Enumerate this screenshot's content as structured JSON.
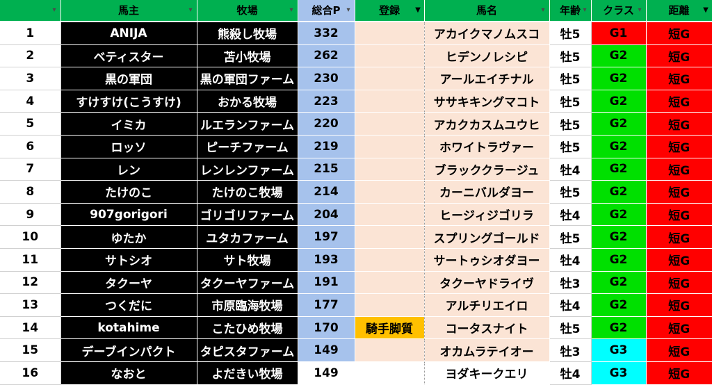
{
  "header": {
    "columns": [
      "",
      "馬主",
      "牧場",
      "総合P",
      "登録",
      "馬名",
      "年齢",
      "クラス",
      "距離"
    ],
    "filter_active": [
      false,
      false,
      false,
      false,
      true,
      false,
      false,
      false,
      true
    ]
  },
  "colors": {
    "G1": "#ff0000",
    "G2": "#00e000",
    "G3": "#00ffff",
    "header": "#00b050",
    "points": "#a6c2ec",
    "peach": "#fbe4d5",
    "jockey": "#ffc000"
  },
  "rows": [
    {
      "no": "1",
      "owner": "ANIJA",
      "farm": "熊殺し牧場",
      "points": "332",
      "reg": "",
      "horse": "アカイクマノムスコ",
      "age": "牡5",
      "cls": "G1",
      "dist": "短G"
    },
    {
      "no": "2",
      "owner": "ベティスター",
      "farm": "苫小牧場",
      "points": "262",
      "reg": "",
      "horse": "ヒデンノレシピ",
      "age": "牡5",
      "cls": "G2",
      "dist": "短G"
    },
    {
      "no": "3",
      "owner": "黒の軍団",
      "farm": "黒の軍団ファーム",
      "points": "230",
      "reg": "",
      "horse": "アールエイチナル",
      "age": "牡5",
      "cls": "G2",
      "dist": "短G"
    },
    {
      "no": "4",
      "owner": "すけすけ(こうすけ)",
      "farm": "おかる牧場",
      "points": "223",
      "reg": "",
      "horse": "ササキキングマコト",
      "age": "牡5",
      "cls": "G2",
      "dist": "短G"
    },
    {
      "no": "5",
      "owner": "イミカ",
      "farm": "ルエランファーム",
      "points": "220",
      "reg": "",
      "horse": "アカクカスムユウヒ",
      "age": "牡5",
      "cls": "G2",
      "dist": "短G"
    },
    {
      "no": "6",
      "owner": "ロッソ",
      "farm": "ピーチファーム",
      "points": "219",
      "reg": "",
      "horse": "ホワイトラヴァー",
      "age": "牡5",
      "cls": "G2",
      "dist": "短G"
    },
    {
      "no": "7",
      "owner": "レン",
      "farm": "レンレンファーム",
      "points": "215",
      "reg": "",
      "horse": "ブラッククラージュ",
      "age": "牡4",
      "cls": "G2",
      "dist": "短G"
    },
    {
      "no": "8",
      "owner": "たけのこ",
      "farm": "たけのこ牧場",
      "points": "214",
      "reg": "",
      "horse": "カーニバルダヨー",
      "age": "牡5",
      "cls": "G2",
      "dist": "短G"
    },
    {
      "no": "9",
      "owner": "907gorigori",
      "farm": "ゴリゴリファーム",
      "points": "204",
      "reg": "",
      "horse": "ヒージィジゴリラ",
      "age": "牡4",
      "cls": "G2",
      "dist": "短G"
    },
    {
      "no": "10",
      "owner": "ゆたか",
      "farm": "ユタカファーム",
      "points": "197",
      "reg": "",
      "horse": "スプリングゴールド",
      "age": "牡5",
      "cls": "G2",
      "dist": "短G"
    },
    {
      "no": "11",
      "owner": "サトシオ",
      "farm": "サト牧場",
      "points": "193",
      "reg": "",
      "horse": "サートゥシオダヨー",
      "age": "牡4",
      "cls": "G2",
      "dist": "短G"
    },
    {
      "no": "12",
      "owner": "タクーヤ",
      "farm": "タクーヤファーム",
      "points": "191",
      "reg": "",
      "horse": "タクーヤドライヴ",
      "age": "牡3",
      "cls": "G2",
      "dist": "短G"
    },
    {
      "no": "13",
      "owner": "つくだに",
      "farm": "市原臨海牧場",
      "points": "177",
      "reg": "",
      "horse": "アルチリエイロ",
      "age": "牡4",
      "cls": "G2",
      "dist": "短G"
    },
    {
      "no": "14",
      "owner": "kotahime",
      "farm": "こたひめ牧場",
      "points": "170",
      "reg": "騎手脚質",
      "horse": "コータスナイト",
      "age": "牡5",
      "cls": "G2",
      "dist": "短G"
    },
    {
      "no": "15",
      "owner": "デーブインパクト",
      "farm": "タピスタファーム",
      "points": "149",
      "reg": "",
      "horse": "オカムラテイオー",
      "age": "牡3",
      "cls": "G3",
      "dist": "短G"
    },
    {
      "no": "16",
      "owner": "なおと",
      "farm": "よだきい牧場",
      "points": "149",
      "reg": "",
      "horse": "ヨダキークエリ",
      "age": "牡4",
      "cls": "G3",
      "dist": "短G"
    }
  ]
}
